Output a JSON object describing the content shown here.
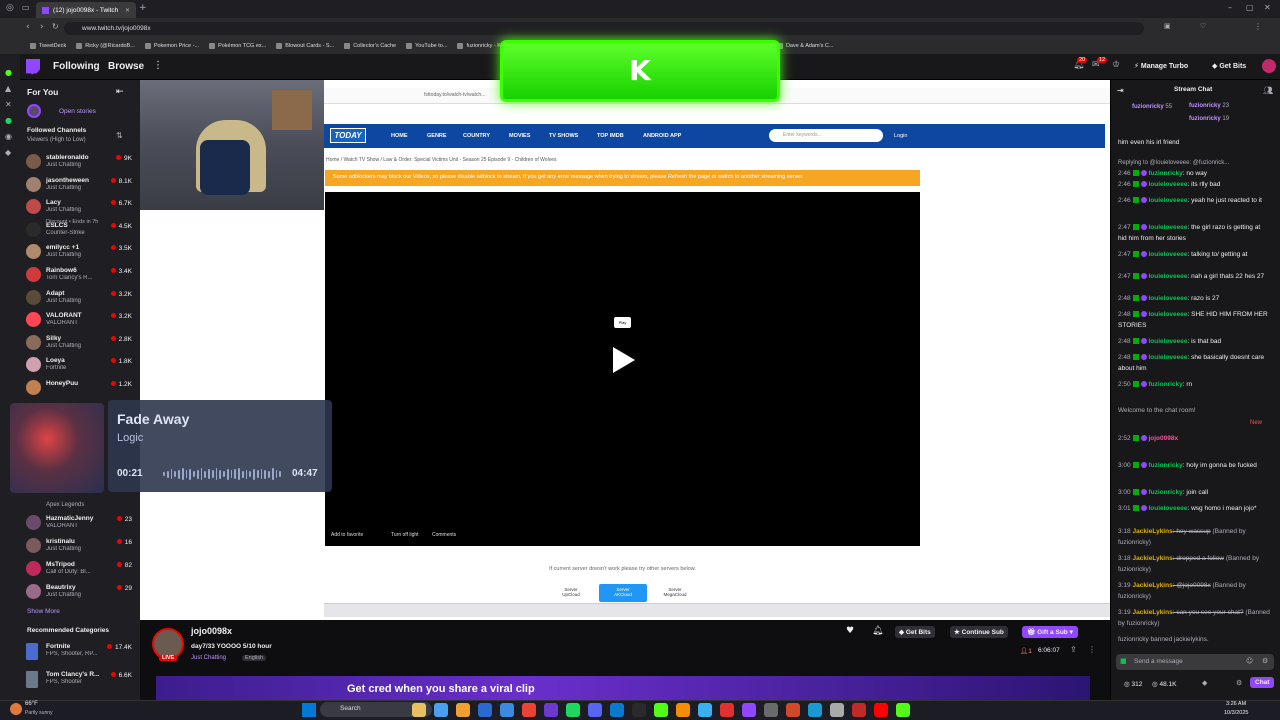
{
  "browser": {
    "tab_title": "(12) jojo0098x - Twitch",
    "url": "www.twitch.tv/jojo0098x",
    "bookmarks": [
      "TweetDeck",
      "Ricky (@RicardoB...",
      "Pokemon Price -...",
      "Pokémon TCG ex...",
      "Blowout Cards - S...",
      "Collector's Cache",
      "YouTube to...",
      "fuzionricky - Kick...",
      "fuzionricky | Kick...",
      "Odds Converter -...",
      "Band Merch - T-S...",
      "TwitchFollowing",
      "Dave & Adam's C..."
    ]
  },
  "twitch": {
    "nav": {
      "following": "Following",
      "browse": "Browse",
      "manage_turbo": "Manage Turbo",
      "get_bits": "Get Bits",
      "notif_count": "20",
      "inbox_count": "12"
    },
    "sidebar": {
      "for_you": "For You",
      "open_stories": "Open stories",
      "followed_channels": "Followed Channels",
      "sort": "Viewers (High to Low)",
      "channels": [
        {
          "name": "stableronaldo",
          "game": "Just Chatting",
          "viewers": "9K",
          "color": "#7a5a4a"
        },
        {
          "name": "jasontheween",
          "game": "Just Chatting",
          "viewers": "8.1K",
          "color": "#a08070"
        },
        {
          "name": "Lacy",
          "game": "Just Chatting",
          "viewers": "6.7K",
          "color": "#c04a4a"
        },
        {
          "name": "ESLCS",
          "game": "Counter-Strike",
          "viewers": "4.5K",
          "color": "#2a2a2a"
        },
        {
          "name": "emilycc +1",
          "game": "Just Chatting",
          "viewers": "3.5K",
          "color": "#b08a6a"
        },
        {
          "name": "Rainbow6",
          "game": "Tom Clancy's R...",
          "viewers": "3.4K",
          "color": "#d03a3a"
        },
        {
          "name": "Adapt",
          "game": "Just Chatting",
          "viewers": "3.2K",
          "color": "#5a4a3a"
        },
        {
          "name": "VALORANT",
          "game": "VALORANT",
          "viewers": "3.2K",
          "color": "#ff4655"
        },
        {
          "name": "Silky",
          "game": "Just Chatting",
          "viewers": "2.8K",
          "color": "#8a6a5a"
        },
        {
          "name": "Loeya",
          "game": "Fortnite",
          "viewers": "1.8K",
          "color": "#d0a0b0"
        },
        {
          "name": "HoneyPuu",
          "game": "",
          "viewers": "1.2K",
          "color": "#c08050"
        }
      ],
      "lacy_note": "Discount • Ends in 7h",
      "channels2": [
        {
          "name": "HazmaticJenny",
          "game": "VALORANT",
          "viewers": "23",
          "color": "#6a4a6a"
        },
        {
          "name": "kristinalu",
          "game": "Just Chatting",
          "viewers": "16",
          "color": "#7a5a5a"
        },
        {
          "name": "MsTripod",
          "game": "Call of Duty: Bl...",
          "viewers": "82",
          "color": "#c02a5a"
        },
        {
          "name": "Beautrixy",
          "game": "Just Chatting",
          "viewers": "29",
          "color": "#9a6a8a"
        }
      ],
      "apex": "Apex Legends",
      "show_more": "Show More",
      "recommended": "Recommended Categories",
      "categories": [
        {
          "name": "Fortnite",
          "tags": "FPS, Shooter, RP...",
          "viewers": "17.4K",
          "color": "#4a6ad0"
        },
        {
          "name": "Tom Clancy's R...",
          "tags": "FPS, Shooter",
          "viewers": "6.6K",
          "color": "#6a7a8a"
        }
      ]
    },
    "stream": {
      "streamer": "jojo0098x",
      "title": "day7/33 YOOOO 5/10 hour",
      "category": "Just Chatting",
      "language": "English",
      "live": "LIVE",
      "viewers": "1",
      "uptime": "6:06:07",
      "get_bits": "Get Bits",
      "continue_sub": "Continue Sub",
      "gift_sub": "Gift a Sub",
      "banner": "Get cred when you share a viral clip"
    },
    "chat": {
      "header": "Stream Chat",
      "hype_users": [
        {
          "name": "fuzionricky",
          "count": "55"
        },
        {
          "name": "fuzionricky",
          "count": "23"
        },
        {
          "name": "fuzionricky",
          "count": "19"
        }
      ],
      "pinned_tail": "him even his irl friend",
      "reply_to": "Replying to @louieloveeee: @fuzionrick...",
      "messages": [
        {
          "time": "2:46",
          "user": "fuzionricky",
          "text": "no way",
          "color": "#00c853"
        },
        {
          "time": "2:46",
          "user": "louieloveeee",
          "text": "its rlly bad",
          "color": "#00c853"
        },
        {
          "time": "2:46",
          "user": "louieloveeee",
          "text": "yeah he just reacted to it",
          "color": "#00c853"
        },
        {
          "time": "2:47",
          "user": "louieloveeee",
          "text": "the girl razo is getting at hid him from her stories",
          "color": "#00c853"
        },
        {
          "time": "2:47",
          "user": "louieloveeee",
          "text": "talking to/ getting at",
          "color": "#00c853"
        },
        {
          "time": "2:47",
          "user": "louieloveeee",
          "text": "nah a girl thats 22 hes 27",
          "color": "#00c853"
        },
        {
          "time": "2:48",
          "user": "louieloveeee",
          "text": "razo is 27",
          "color": "#00c853"
        },
        {
          "time": "2:48",
          "user": "louieloveeee",
          "text": "SHE HID HIM FROM HER STORIES",
          "color": "#00c853"
        },
        {
          "time": "2:48",
          "user": "louieloveeee",
          "text": "is that bad",
          "color": "#00c853"
        },
        {
          "time": "2:48",
          "user": "louieloveeee",
          "text": "she basically doesnt care about him",
          "color": "#00c853"
        },
        {
          "time": "2:50",
          "user": "fuzionricky",
          "text": "rn",
          "color": "#00c853"
        }
      ],
      "welcome": "Welcome to the chat room!",
      "new_label": "New",
      "messages2": [
        {
          "time": "2:52",
          "user": "jojo0098x",
          "text": "",
          "color": "#ff4d9a"
        },
        {
          "time": "3:00",
          "user": "fuzionricky",
          "text": "holy im gonna be fucked",
          "color": "#00c853"
        },
        {
          "time": "3:00",
          "user": "fuzionricky",
          "text": "join call",
          "color": "#00c853"
        },
        {
          "time": "3:01",
          "user": "louieloveeee",
          "text": "wsg homo i mean jojo*",
          "color": "#00c853"
        }
      ],
      "banned": [
        {
          "time": "3:18",
          "user": "JackieLykins",
          "text": "hey wassup",
          "note": "(Banned by fuzionricky)"
        },
        {
          "time": "3:18",
          "user": "JackieLykins",
          "text": "dropped a follow",
          "note": "(Banned by fuzionricky)"
        },
        {
          "time": "3:19",
          "user": "JackieLykins",
          "text": "@jojo0098x",
          "note": "(Banned by fuzionricky)"
        },
        {
          "time": "3:19",
          "user": "JackieLykins",
          "text": "can you see your chat?",
          "note": "(Banned by fuzionricky)"
        }
      ],
      "ban_notice": "fuzionricky banned jackielykins.",
      "input_placeholder": "Send a message",
      "points": "312",
      "points2": "48.1K",
      "chat_button": "Chat"
    }
  },
  "embedded_site": {
    "url": "fsttoday.to/watch-tv/watch...",
    "logo": "TODAY",
    "nav": [
      "HOME",
      "GENRE",
      "COUNTRY",
      "MOVIES",
      "TV SHOWS",
      "TOP IMDB",
      "ANDROID APP"
    ],
    "search_placeholder": "Enter keywords...",
    "login": "Login",
    "breadcrumb": "Home  /  Watch TV Show  /  Law & Order: Special Victims Unit - Season 25  Episode 9 - Children of Wolves",
    "warning": "Some adblockers may block our Videos, so please disable adblock to stream, If you get any error message when trying to stream, please Refresh the page or switch to another streaming server.",
    "play_tip": "Play",
    "controls": [
      "Add to favorite",
      "Turn off light",
      "Comments"
    ],
    "server_msg": "If current server doesn't work please try other servers below.",
    "servers": [
      {
        "label": "Server",
        "name": "UpCloud"
      },
      {
        "label": "Server",
        "name": "AKCloud"
      },
      {
        "label": "Server",
        "name": "MegaCloud"
      }
    ]
  },
  "kick_overlay": {
    "letter": "K",
    "color": "#53fc18"
  },
  "music": {
    "title": "Fade Away",
    "artist": "Logic",
    "elapsed": "00:21",
    "duration": "04:47"
  },
  "taskbar": {
    "weather_temp": "66°F",
    "weather_desc": "Partly sunny",
    "search": "Search",
    "time": "3:26 AM",
    "date": "10/3/2025"
  }
}
